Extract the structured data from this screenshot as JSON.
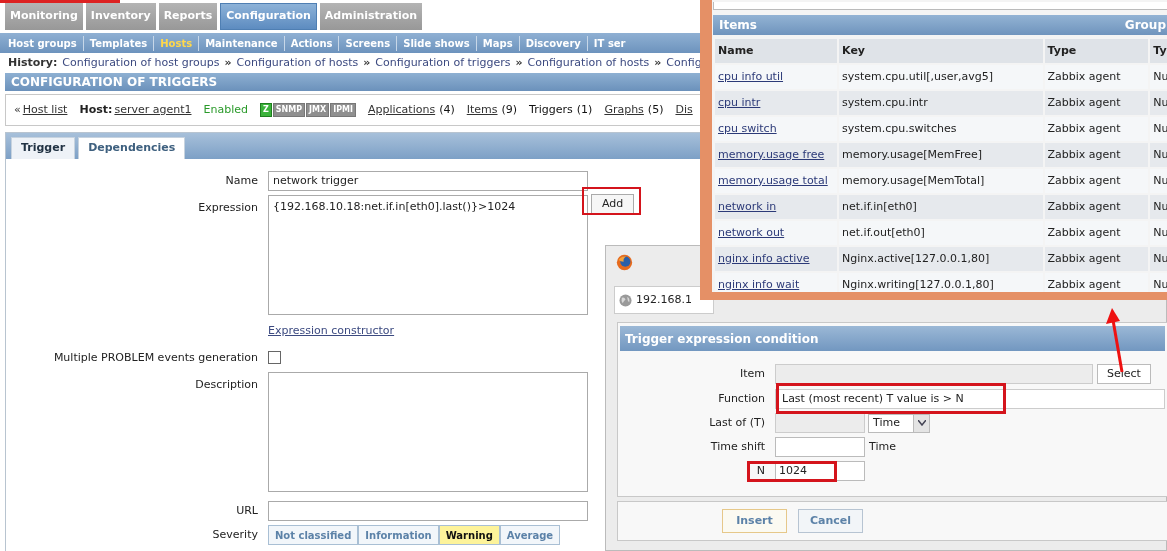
{
  "top_menu": [
    {
      "label": "Monitoring",
      "selected": false
    },
    {
      "label": "Inventory",
      "selected": false
    },
    {
      "label": "Reports",
      "selected": false
    },
    {
      "label": "Configuration",
      "selected": true
    },
    {
      "label": "Administration",
      "selected": false
    }
  ],
  "sub_menu": [
    {
      "label": "Host groups",
      "selected": false
    },
    {
      "label": "Templates",
      "selected": false
    },
    {
      "label": "Hosts",
      "selected": true
    },
    {
      "label": "Maintenance",
      "selected": false
    },
    {
      "label": "Actions",
      "selected": false
    },
    {
      "label": "Screens",
      "selected": false
    },
    {
      "label": "Slide shows",
      "selected": false
    },
    {
      "label": "Maps",
      "selected": false
    },
    {
      "label": "Discovery",
      "selected": false
    },
    {
      "label": "IT ser",
      "selected": false
    }
  ],
  "history": {
    "label": "History:",
    "links": [
      "Configuration of host groups",
      "Configuration of hosts",
      "Configuration of triggers",
      "Configuration of hosts",
      "Config"
    ],
    "separator": "»"
  },
  "page_title": "CONFIGURATION OF TRIGGERS",
  "host_bar": {
    "back_mark": "«",
    "back_link": "Host list",
    "host_label": "Host:",
    "host_name": "server agent1",
    "status": "Enabled",
    "availability": [
      {
        "label": "Z",
        "available": true
      },
      {
        "label": "SNMP",
        "available": false
      },
      {
        "label": "JMX",
        "available": false
      },
      {
        "label": "IPMI",
        "available": false
      }
    ],
    "links": [
      {
        "label": "Applications",
        "count": "(4)",
        "link": true
      },
      {
        "label": "Items",
        "count": "(9)",
        "link": true
      },
      {
        "label": "Triggers",
        "count": "(1)",
        "link": false
      },
      {
        "label": "Graphs",
        "count": "(5)",
        "link": true
      },
      {
        "label": "Dis",
        "link": true
      }
    ]
  },
  "form": {
    "tabs": [
      {
        "label": "Trigger",
        "selected": true
      },
      {
        "label": "Dependencies",
        "selected": false
      }
    ],
    "name_label": "Name",
    "name_value": "network trigger",
    "expression_label": "Expression",
    "expression_value": "{192.168.10.18:net.if.in[eth0].last()}>1024",
    "add_button": "Add",
    "constructor_link": "Expression constructor",
    "multiple_label": "Multiple PROBLEM events generation",
    "multiple_checked": false,
    "description_label": "Description",
    "url_label": "URL",
    "severity_label": "Severity",
    "severities": [
      {
        "label": "Not classified",
        "selected": false
      },
      {
        "label": "Information",
        "selected": false
      },
      {
        "label": "Warning",
        "selected": true
      },
      {
        "label": "Average",
        "selected": false
      }
    ]
  },
  "condition_window": {
    "address": "192.168.1",
    "title": "Trigger expression condition",
    "item_label": "Item",
    "select_button": "Select",
    "function_label": "Function",
    "function_value": "Last (most recent) T value is > N",
    "last_label": "Last of (T)",
    "last_unit": "Time",
    "time_shift_label": "Time shift",
    "time_shift_unit": "Time",
    "n_label": "N",
    "n_value": "1024",
    "buttons": [
      {
        "label": "Insert",
        "kind": "primary"
      },
      {
        "label": "Cancel",
        "kind": "secondary"
      }
    ]
  },
  "items_window": {
    "title": "Items",
    "title_right": "Group",
    "columns": [
      "Name",
      "Key",
      "Type",
      "Ty"
    ],
    "rows": [
      {
        "name": "cpu info util",
        "key": "system.cpu.util[,user,avg5]",
        "type": "Zabbix agent",
        "column_4": "Nu"
      },
      {
        "name": "cpu intr",
        "key": "system.cpu.intr",
        "type": "Zabbix agent",
        "column_4": "Nu"
      },
      {
        "name": "cpu switch",
        "key": "system.cpu.switches",
        "type": "Zabbix agent",
        "column_4": "Nu"
      },
      {
        "name": "memory.usage free",
        "key": "memory.usage[MemFree]",
        "type": "Zabbix agent",
        "column_4": "Nu"
      },
      {
        "name": "memory.usage total",
        "key": "memory.usage[MemTotal]",
        "type": "Zabbix agent",
        "column_4": "Nu"
      },
      {
        "name": "network in",
        "key": "net.if.in[eth0]",
        "type": "Zabbix agent",
        "column_4": "Nu"
      },
      {
        "name": "network out",
        "key": "net.if.out[eth0]",
        "type": "Zabbix agent",
        "column_4": "Nu"
      },
      {
        "name": "nginx info active",
        "key": "Nginx.active[127.0.0.1,80]",
        "type": "Zabbix agent",
        "column_4": "Nu"
      },
      {
        "name": "nginx info wait",
        "key": "Nginx.writing[127.0.0.1,80]",
        "type": "Zabbix agent",
        "column_4": "Nu"
      }
    ]
  }
}
